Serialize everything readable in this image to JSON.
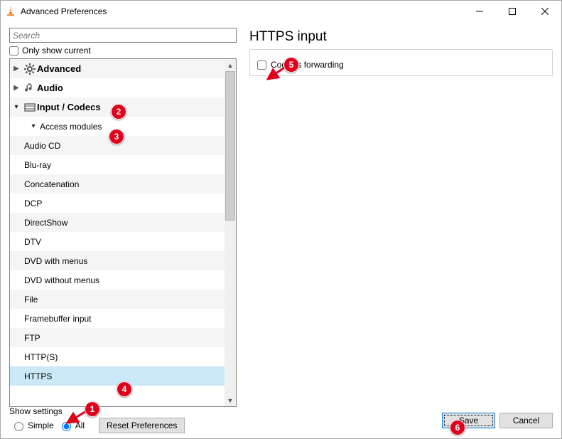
{
  "window": {
    "title": "Advanced Preferences"
  },
  "search": {
    "placeholder": "Search"
  },
  "only_show_current": "Only show current",
  "tree": {
    "advanced": "Advanced",
    "audio": "Audio",
    "input_codecs": "Input / Codecs",
    "access_modules": "Access modules",
    "children": {
      "audio_cd": "Audio CD",
      "bluray": "Blu-ray",
      "concatenation": "Concatenation",
      "dcp": "DCP",
      "directshow": "DirectShow",
      "dtv": "DTV",
      "dvd_with_menus": "DVD with menus",
      "dvd_without_menus": "DVD without menus",
      "file": "File",
      "framebuffer": "Framebuffer input",
      "ftp": "FTP",
      "https_paren": "HTTP(S)",
      "https": "HTTPS"
    }
  },
  "right": {
    "title": "HTTPS input",
    "opt_cookies": "Cookies forwarding"
  },
  "bottom": {
    "show_settings": "Show settings",
    "simple": "Simple",
    "all": "All",
    "reset": "Reset Preferences",
    "save": "Save",
    "cancel": "Cancel"
  },
  "annotations": [
    "1",
    "2",
    "3",
    "4",
    "5",
    "6"
  ]
}
